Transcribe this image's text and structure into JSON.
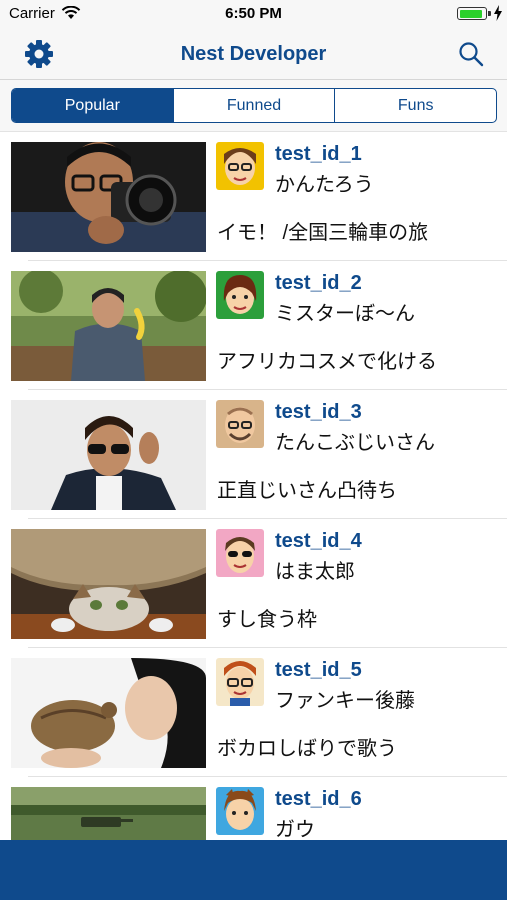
{
  "status": {
    "carrier": "Carrier",
    "time": "6:50 PM",
    "battery_level": 0.9
  },
  "nav": {
    "title": "Nest Developer",
    "settings_icon": "gear-icon",
    "search_icon": "search-icon"
  },
  "segments": [
    {
      "label": "Popular",
      "selected": true
    },
    {
      "label": "Funned",
      "selected": false
    },
    {
      "label": "Funs",
      "selected": false
    }
  ],
  "colors": {
    "accent": "#0f4a8c",
    "battery": "#2bd12b"
  },
  "items": [
    {
      "user_id": "test_id_1",
      "name": "かんたろう",
      "description": "イモ！ /全国三輪車の旅"
    },
    {
      "user_id": "test_id_2",
      "name": "ミスターぼ～ん",
      "description": "アフリカコスメで化ける"
    },
    {
      "user_id": "test_id_3",
      "name": "たんこぶじいさん",
      "description": "正直じいさん凸待ち"
    },
    {
      "user_id": "test_id_4",
      "name": "はま太郎",
      "description": "すし食う枠"
    },
    {
      "user_id": "test_id_5",
      "name": "ファンキー後藤",
      "description": "ボカロしばりで歌う"
    },
    {
      "user_id": "test_id_6",
      "name": "ガウ",
      "description": ""
    }
  ]
}
